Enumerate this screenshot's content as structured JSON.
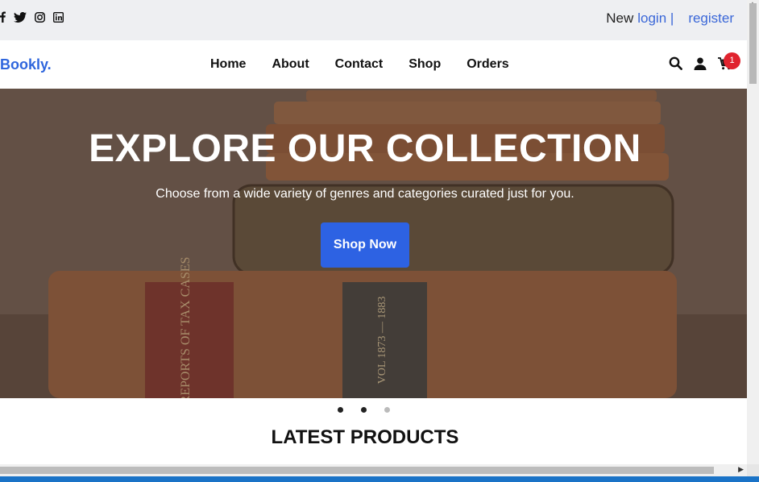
{
  "topbar": {
    "social_icons": [
      "facebook-icon",
      "twitter-icon",
      "instagram-icon",
      "linkedin-icon"
    ],
    "new_label": "New",
    "login_label": "login |",
    "register_label": "register"
  },
  "header": {
    "brand": "Bookly.",
    "nav": [
      "Home",
      "About",
      "Contact",
      "Shop",
      "Orders"
    ],
    "icons": [
      "search-icon",
      "user-icon",
      "cart-icon"
    ],
    "cart_count": "1"
  },
  "hero": {
    "title": "EXPLORE OUR COLLECTION",
    "subtitle": "Choose from a wide variety of genres and categories curated just for you.",
    "cta": "Shop Now",
    "book_spine_top": "REPORTS OF TAX CASES",
    "book_spine_vol": "VOL 1873 — 1883"
  },
  "carousel": {
    "dots": 3,
    "active": 0
  },
  "section": {
    "title": "LATEST PRODUCTS"
  },
  "colors": {
    "accent": "#2d62e3",
    "badge": "#e0232e",
    "topbar": "#eeeff2"
  }
}
